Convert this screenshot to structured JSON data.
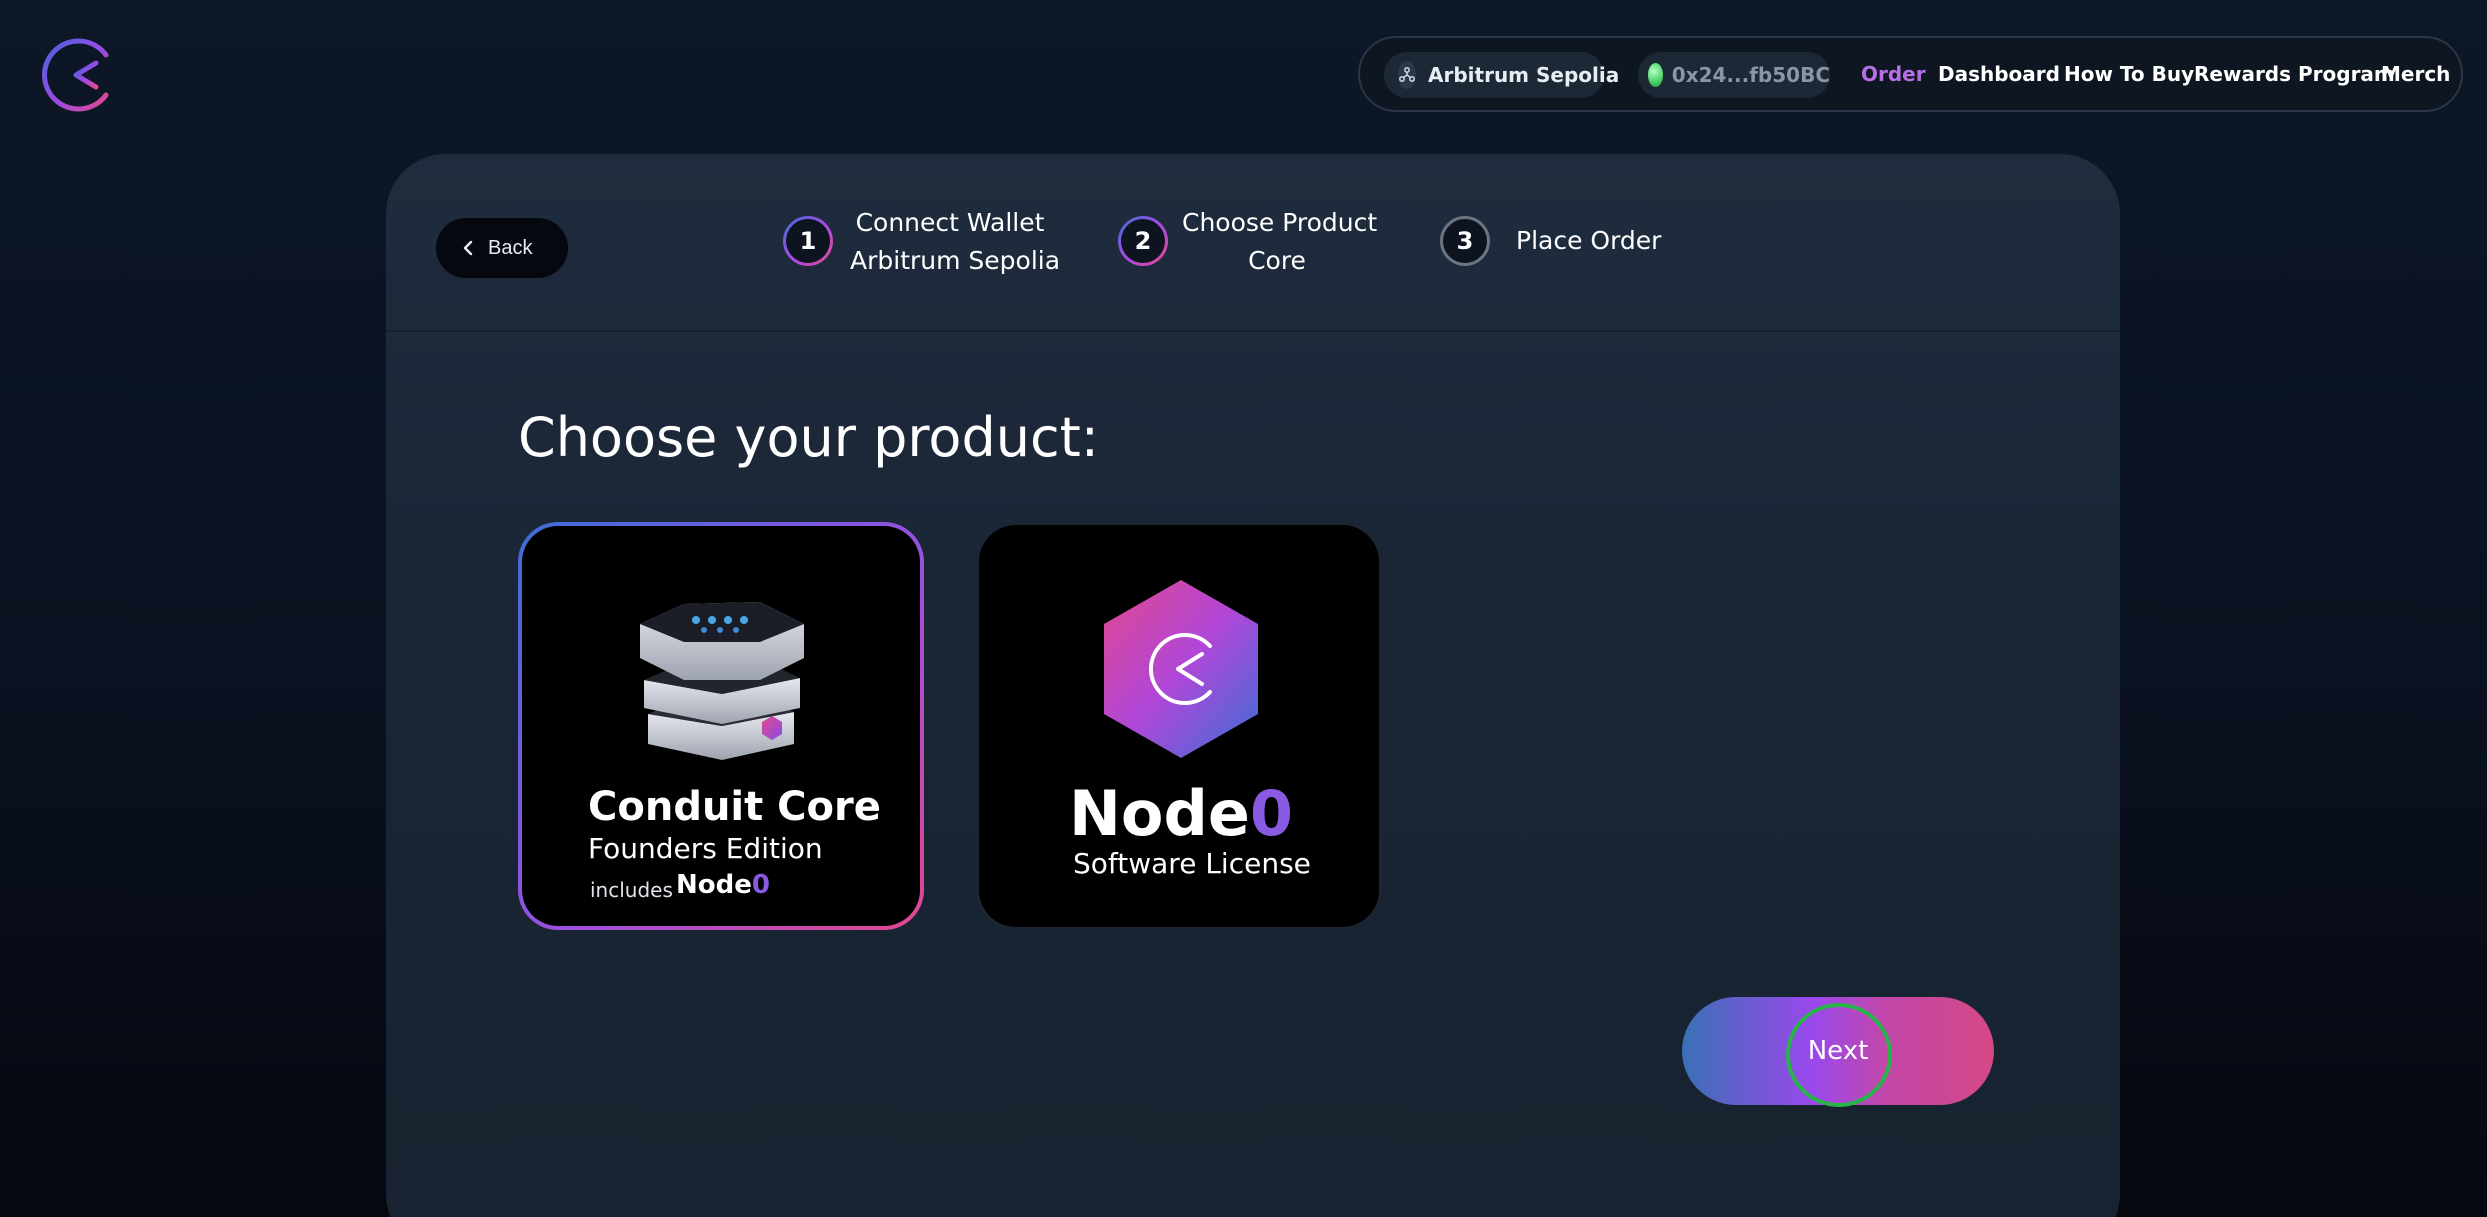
{
  "nav": {
    "network_label": "Arbitrum Sepolia",
    "wallet_address": "0x24...fb50BC",
    "links": [
      "Order",
      "Dashboard",
      "How To Buy",
      "Rewards Program",
      "Merch"
    ],
    "active_link": "Order"
  },
  "stepper": {
    "back_label": "Back",
    "steps": [
      {
        "number": "1",
        "line1": "Connect Wallet",
        "line2": "Arbitrum Sepolia"
      },
      {
        "number": "2",
        "line1": "Choose Product",
        "line2": "Core"
      },
      {
        "number": "3",
        "line1": "Place Order",
        "line2": ""
      }
    ]
  },
  "main": {
    "heading": "Choose your product:",
    "products": [
      {
        "title": "Conduit Core",
        "subtitle": "Founders Edition",
        "includes": "includes",
        "includes_brand": "Node",
        "includes_brand_suffix": "0",
        "selected": true
      },
      {
        "brand": "Node",
        "brand_suffix": "0",
        "subtitle": "Software License",
        "selected": false
      }
    ],
    "next_label": "Next"
  },
  "colors": {
    "accent_purple": "#9a48ec",
    "accent_pink": "#e2488f",
    "accent_blue": "#3a70b5",
    "active_nav": "#b86fe6",
    "wallet_dot": "#4bd76a",
    "focus_ring": "#27b54a"
  },
  "icons": {
    "logo": "conduit-c-logo-icon",
    "network": "arbitrum-network-icon",
    "back": "chevron-left-icon"
  }
}
